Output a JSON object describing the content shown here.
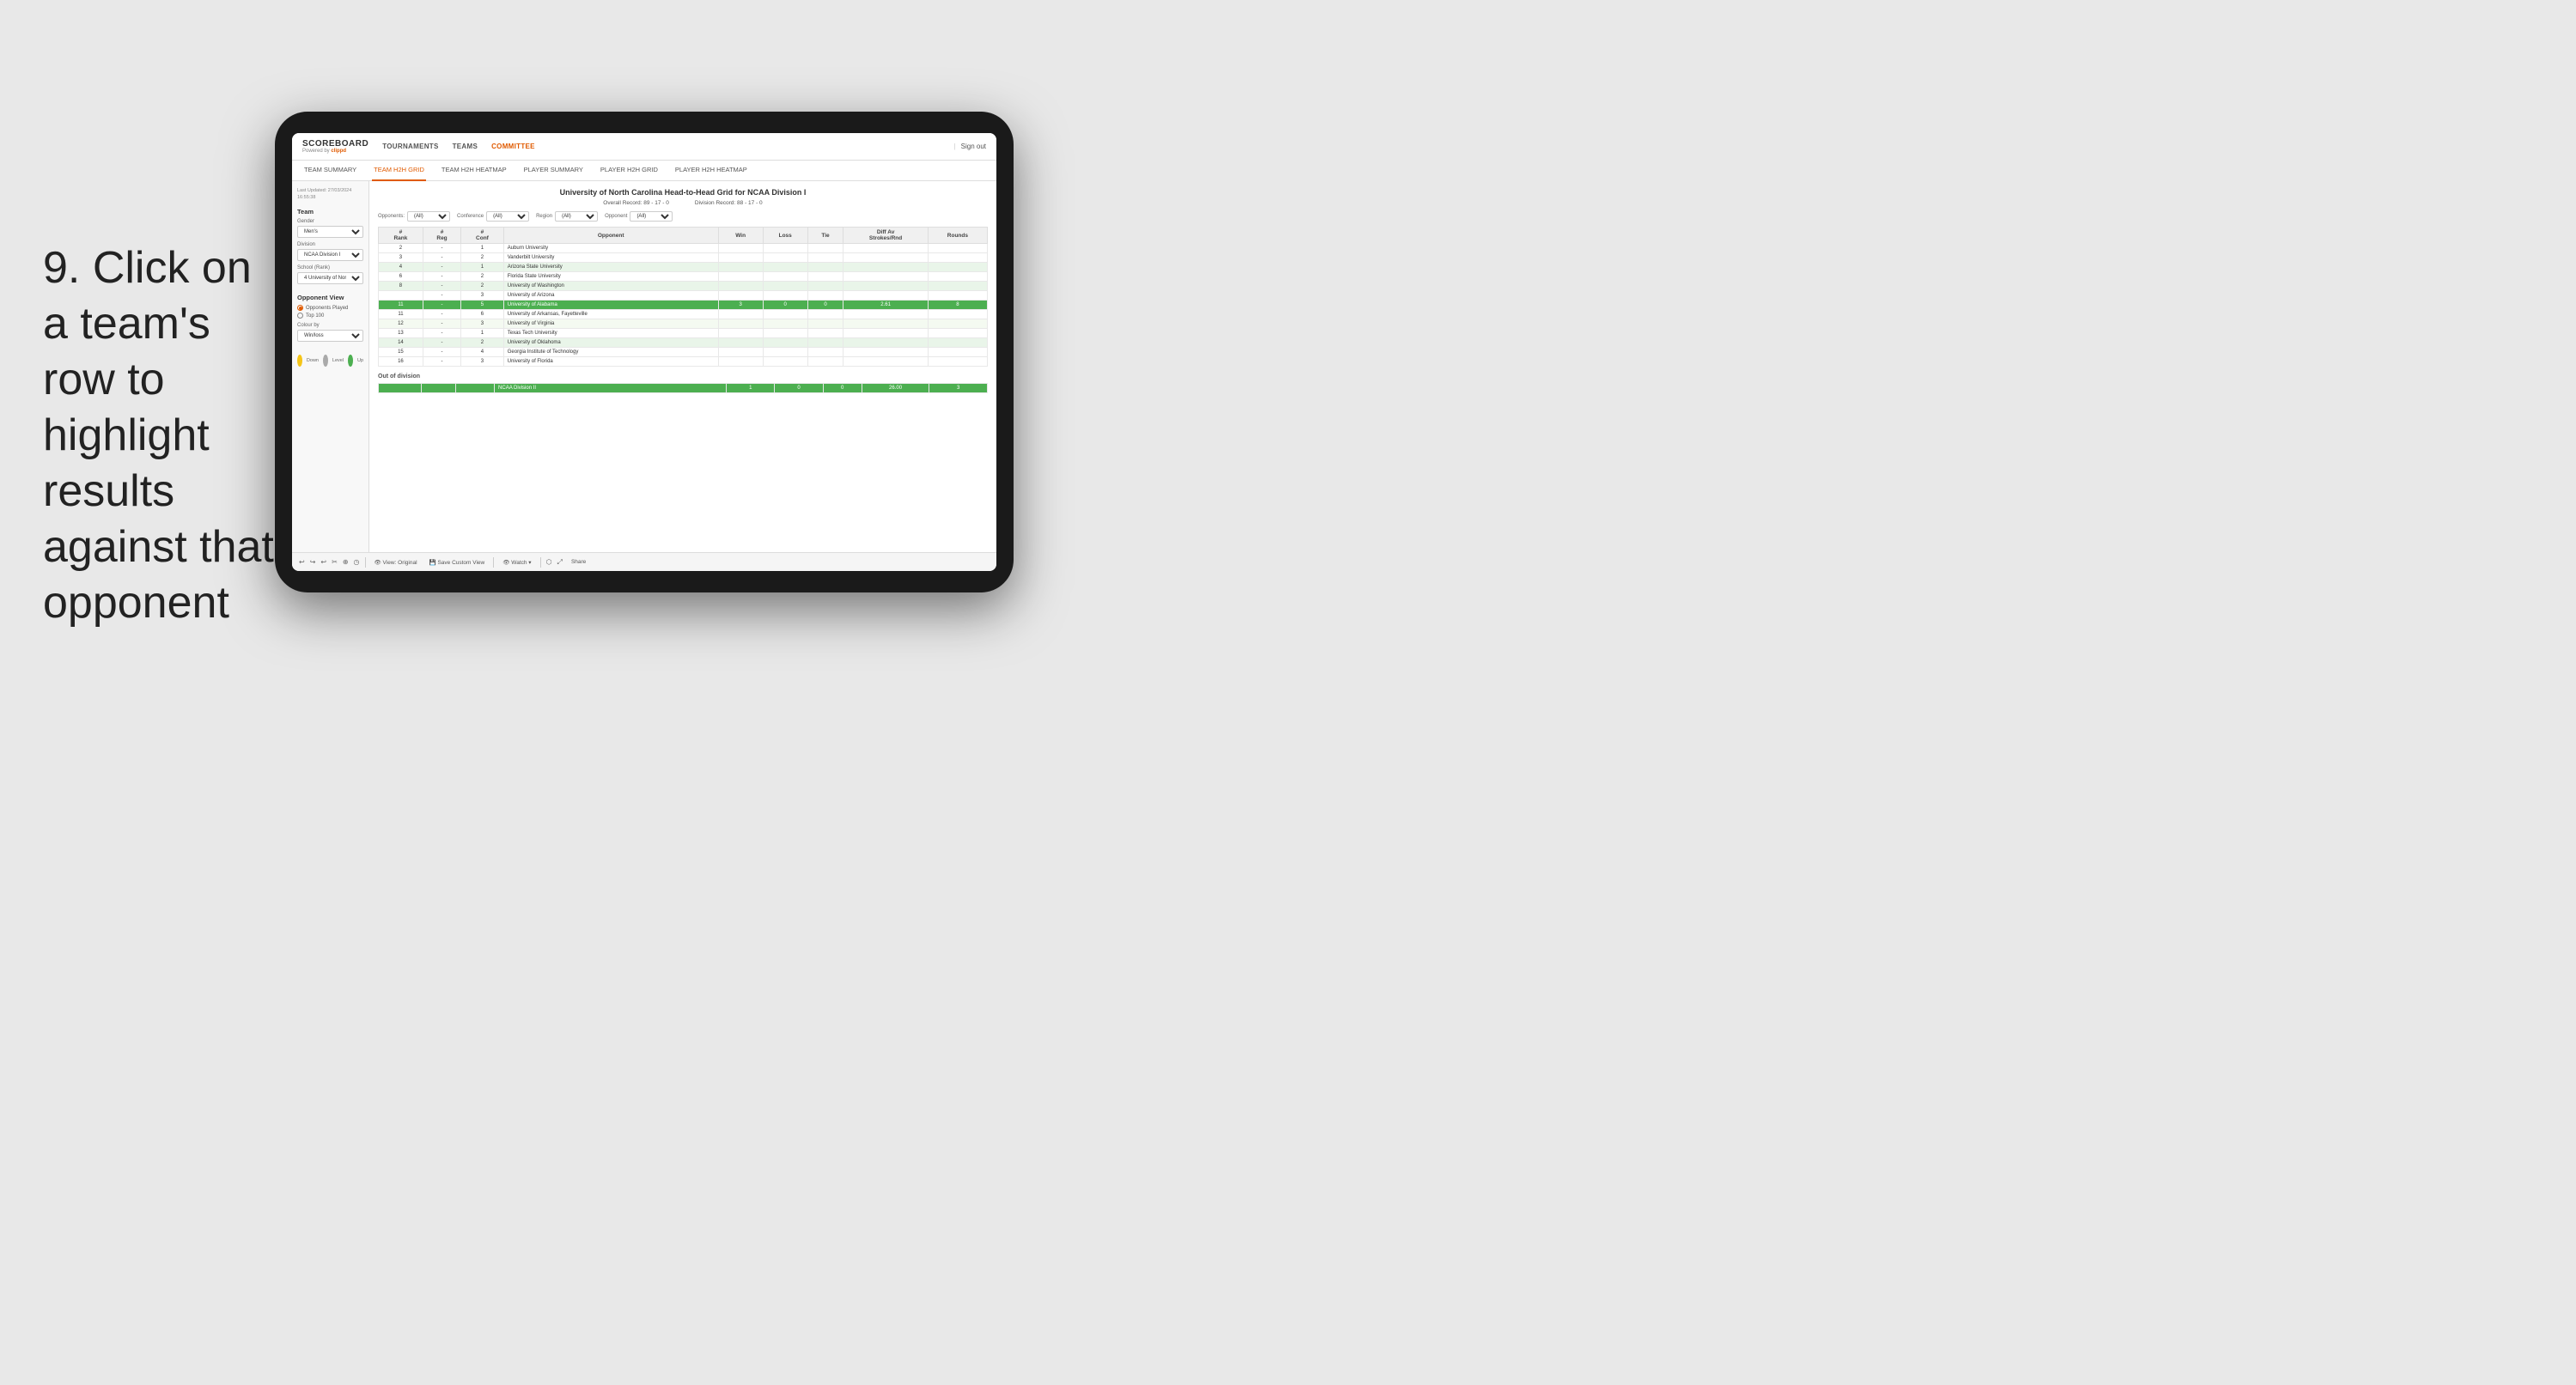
{
  "instruction": {
    "number": "9.",
    "text": "Click on a team's row to highlight results against that opponent"
  },
  "app": {
    "logo": "SCOREBOARD",
    "logo_sub": "Powered by clippd",
    "sign_out_sep": "|",
    "sign_out": "Sign out"
  },
  "nav": {
    "items": [
      "TOURNAMENTS",
      "TEAMS",
      "COMMITTEE"
    ]
  },
  "sub_nav": {
    "items": [
      "TEAM SUMMARY",
      "TEAM H2H GRID",
      "TEAM H2H HEATMAP",
      "PLAYER SUMMARY",
      "PLAYER H2H GRID",
      "PLAYER H2H HEATMAP"
    ],
    "active": "TEAM H2H GRID"
  },
  "sidebar": {
    "updated_label": "Last Updated: 27/03/2024",
    "updated_time": "16:55:38",
    "team_label": "Team",
    "gender_label": "Gender",
    "gender_value": "Men's",
    "division_label": "Division",
    "division_value": "NCAA Division I",
    "school_label": "School (Rank)",
    "school_value": "4 University of Nort...",
    "opponent_view_label": "Opponent View",
    "opp_opponents": "Opponents Played",
    "opp_top100": "Top 100",
    "colour_by_label": "Colour by",
    "colour_by_value": "Win/loss",
    "legend": [
      {
        "label": "Down",
        "color": "#f5c518"
      },
      {
        "label": "Level",
        "color": "#aaa"
      },
      {
        "label": "Up",
        "color": "#4caf50"
      }
    ]
  },
  "grid": {
    "title": "University of North Carolina Head-to-Head Grid for NCAA Division I",
    "overall_record_label": "Overall Record:",
    "overall_record": "89 - 17 - 0",
    "division_record_label": "Division Record:",
    "division_record": "88 - 17 - 0",
    "filters": {
      "opponents_label": "Opponents:",
      "opponents_value": "(All)",
      "conference_label": "Conference",
      "conference_value": "(All)",
      "region_label": "Region",
      "region_value": "(All)",
      "opponent_label": "Opponent",
      "opponent_value": "(All)"
    },
    "columns": {
      "rank": "#\nRank",
      "reg": "#\nReg",
      "conf": "#\nConf",
      "opponent": "Opponent",
      "win": "Win",
      "loss": "Loss",
      "tie": "Tie",
      "diff": "Diff Av\nStrokes/Rnd",
      "rounds": "Rounds"
    },
    "rows": [
      {
        "rank": "2",
        "reg": "-",
        "conf": "1",
        "opponent": "Auburn University",
        "win": "",
        "loss": "",
        "tie": "",
        "diff": "",
        "rounds": "",
        "highlight": "none"
      },
      {
        "rank": "3",
        "reg": "-",
        "conf": "2",
        "opponent": "Vanderbilt University",
        "win": "",
        "loss": "",
        "tie": "",
        "diff": "",
        "rounds": "",
        "highlight": "none"
      },
      {
        "rank": "4",
        "reg": "-",
        "conf": "1",
        "opponent": "Arizona State University",
        "win": "",
        "loss": "",
        "tie": "",
        "diff": "",
        "rounds": "",
        "highlight": "light"
      },
      {
        "rank": "6",
        "reg": "-",
        "conf": "2",
        "opponent": "Florida State University",
        "win": "",
        "loss": "",
        "tie": "",
        "diff": "",
        "rounds": "",
        "highlight": "none"
      },
      {
        "rank": "8",
        "reg": "-",
        "conf": "2",
        "opponent": "University of Washington",
        "win": "",
        "loss": "",
        "tie": "",
        "diff": "",
        "rounds": "",
        "highlight": "light"
      },
      {
        "rank": "",
        "reg": "-",
        "conf": "3",
        "opponent": "University of Arizona",
        "win": "",
        "loss": "",
        "tie": "",
        "diff": "",
        "rounds": "",
        "highlight": "none"
      },
      {
        "rank": "11",
        "reg": "-",
        "conf": "5",
        "opponent": "University of Alabama",
        "win": "3",
        "loss": "0",
        "tie": "0",
        "diff": "2.61",
        "rounds": "8",
        "highlight": "green"
      },
      {
        "rank": "11",
        "reg": "-",
        "conf": "6",
        "opponent": "University of Arkansas, Fayetteville",
        "win": "",
        "loss": "",
        "tie": "",
        "diff": "",
        "rounds": "",
        "highlight": "none"
      },
      {
        "rank": "12",
        "reg": "-",
        "conf": "3",
        "opponent": "University of Virginia",
        "win": "",
        "loss": "",
        "tie": "",
        "diff": "",
        "rounds": "",
        "highlight": "very-light"
      },
      {
        "rank": "13",
        "reg": "-",
        "conf": "1",
        "opponent": "Texas Tech University",
        "win": "",
        "loss": "",
        "tie": "",
        "diff": "",
        "rounds": "",
        "highlight": "none"
      },
      {
        "rank": "14",
        "reg": "-",
        "conf": "2",
        "opponent": "University of Oklahoma",
        "win": "",
        "loss": "",
        "tie": "",
        "diff": "",
        "rounds": "",
        "highlight": "light"
      },
      {
        "rank": "15",
        "reg": "-",
        "conf": "4",
        "opponent": "Georgia Institute of Technology",
        "win": "",
        "loss": "",
        "tie": "",
        "diff": "",
        "rounds": "",
        "highlight": "none"
      },
      {
        "rank": "16",
        "reg": "-",
        "conf": "3",
        "opponent": "University of Florida",
        "win": "",
        "loss": "",
        "tie": "",
        "diff": "",
        "rounds": "",
        "highlight": "none"
      }
    ],
    "out_of_division_label": "Out of division",
    "out_of_division_row": {
      "label": "NCAA Division II",
      "win": "1",
      "loss": "0",
      "tie": "0",
      "diff": "26.00",
      "rounds": "3"
    }
  },
  "toolbar": {
    "items": [
      "↩",
      "↪",
      "↩",
      "✂",
      "⊕",
      "◷",
      "|",
      "👁 View: Original",
      "💾 Save Custom View",
      "|",
      "👁 Watch ▾",
      "|",
      "⬡",
      "⤢",
      "Share"
    ]
  }
}
